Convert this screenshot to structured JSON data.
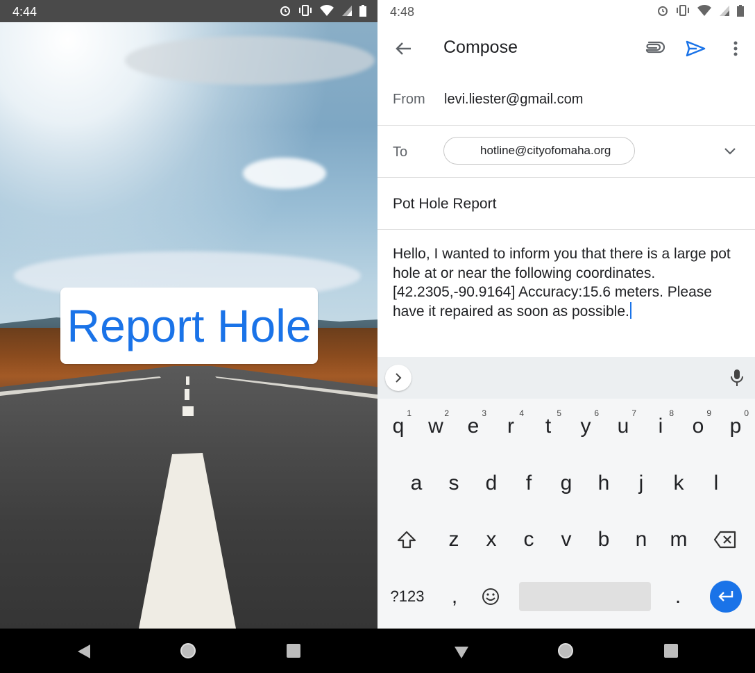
{
  "left": {
    "status_time": "4:44",
    "button_label": "Report Hole"
  },
  "right": {
    "status_time": "4:48",
    "toolbar": {
      "title": "Compose"
    },
    "from": {
      "label": "From",
      "value": "levi.liester@gmail.com"
    },
    "to": {
      "label": "To",
      "recipient": "hotline@cityofomaha.org"
    },
    "subject": "Pot Hole Report",
    "body": "Hello, I wanted to inform you that there is a large pot hole at or near the following coordinates.  [42.2305,-90.9164] Accuracy:15.6 meters. Please have it repaired as soon as possible.",
    "keyboard": {
      "row1": [
        {
          "key": "q",
          "hint": "1"
        },
        {
          "key": "w",
          "hint": "2"
        },
        {
          "key": "e",
          "hint": "3"
        },
        {
          "key": "r",
          "hint": "4"
        },
        {
          "key": "t",
          "hint": "5"
        },
        {
          "key": "y",
          "hint": "6"
        },
        {
          "key": "u",
          "hint": "7"
        },
        {
          "key": "i",
          "hint": "8"
        },
        {
          "key": "o",
          "hint": "9"
        },
        {
          "key": "p",
          "hint": "0"
        }
      ],
      "row2": [
        "a",
        "s",
        "d",
        "f",
        "g",
        "h",
        "j",
        "k",
        "l"
      ],
      "row3": [
        "z",
        "x",
        "c",
        "v",
        "b",
        "n",
        "m"
      ],
      "symbols_label": "?123",
      "comma": ",",
      "period": "."
    }
  },
  "colors": {
    "accent": "#1a73e8",
    "keyboard_bg": "#f5f6f7"
  },
  "icons": [
    "alarm-icon",
    "vibrate-icon",
    "wifi-icon",
    "signal-icon",
    "battery-icon",
    "back-arrow-icon",
    "attach-icon",
    "send-icon",
    "more-vert-icon",
    "chevron-down-icon",
    "chevron-right-icon",
    "mic-icon",
    "shift-icon",
    "backspace-icon",
    "emoji-icon",
    "enter-icon",
    "nav-back-icon",
    "nav-home-icon",
    "nav-recent-icon"
  ]
}
